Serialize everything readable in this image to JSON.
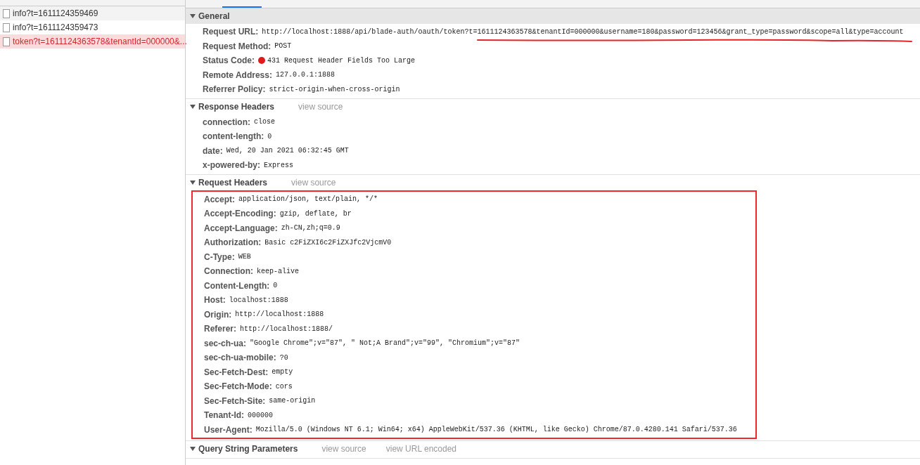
{
  "requests": [
    {
      "name": "info?t=1611124359469",
      "failed": false,
      "selected": false
    },
    {
      "name": "info?t=1611124359473",
      "failed": false,
      "selected": false
    },
    {
      "name": "token?t=1611124363578&tenantId=000000&...",
      "failed": true,
      "selected": true
    }
  ],
  "sections": [
    {
      "title": "General",
      "kind": "bar",
      "expanded": true,
      "rows": [
        {
          "name": "Request URL:",
          "value": "http://localhost:1888/api/blade-auth/oauth/token?t=1611124363578&tenantId=000000&username=180&password=123456&grant_type=password&scope=all&type=account",
          "underlined": true
        },
        {
          "name": "Request Method:",
          "value": "POST"
        },
        {
          "name": "Status Code:",
          "value": "431 Request Header Fields Too Large",
          "color": "#e01b1b"
        },
        {
          "name": "Remote Address:",
          "value": "127.0.0.1:1888"
        },
        {
          "name": "Referrer Policy:",
          "value": "strict-origin-when-cross-origin"
        }
      ]
    },
    {
      "title": "Response Headers",
      "kind": "plain",
      "expanded": true,
      "links": [
        "view source"
      ],
      "rows": [
        {
          "name": "connection:",
          "value": "close"
        },
        {
          "name": "content-length:",
          "value": "0"
        },
        {
          "name": "date:",
          "value": "Wed, 20 Jan 2021 06:32:45 GMT"
        },
        {
          "name": "x-powered-by:",
          "value": "Express"
        }
      ]
    },
    {
      "title": "Request Headers",
      "kind": "plain",
      "expanded": true,
      "links": [
        "view source"
      ],
      "annotated": true,
      "rows": [
        {
          "name": "Accept:",
          "value": "application/json, text/plain, */*"
        },
        {
          "name": "Accept-Encoding:",
          "value": "gzip, deflate, br"
        },
        {
          "name": "Accept-Language:",
          "value": "zh-CN,zh;q=0.9"
        },
        {
          "name": "Authorization:",
          "value": "Basic c2FiZXI6c2FiZXJfc2VjcmV0"
        },
        {
          "name": "C-Type:",
          "value": "WEB"
        },
        {
          "name": "Connection:",
          "value": "keep-alive"
        },
        {
          "name": "Content-Length:",
          "value": "0"
        },
        {
          "name": "Host:",
          "value": "localhost:1888"
        },
        {
          "name": "Origin:",
          "value": "http://localhost:1888"
        },
        {
          "name": "Referer:",
          "value": "http://localhost:1888/"
        },
        {
          "name": "sec-ch-ua:",
          "value": "\"Google Chrome\";v=\"87\", \" Not;A Brand\";v=\"99\", \"Chromium\";v=\"87\""
        },
        {
          "name": "sec-ch-ua-mobile:",
          "value": "?0"
        },
        {
          "name": "Sec-Fetch-Dest:",
          "value": "empty"
        },
        {
          "name": "Sec-Fetch-Mode:",
          "value": "cors"
        },
        {
          "name": "Sec-Fetch-Site:",
          "value": "same-origin"
        },
        {
          "name": "Tenant-Id:",
          "value": "000000"
        },
        {
          "name": "User-Agent:",
          "value": "Mozilla/5.0 (Windows NT 6.1; Win64; x64) AppleWebKit/537.36 (KHTML, like Gecko) Chrome/87.0.4280.141 Safari/537.36"
        }
      ]
    },
    {
      "title": "Query String Parameters",
      "kind": "plain",
      "expanded": true,
      "links": [
        "view source",
        "view URL encoded"
      ]
    }
  ]
}
